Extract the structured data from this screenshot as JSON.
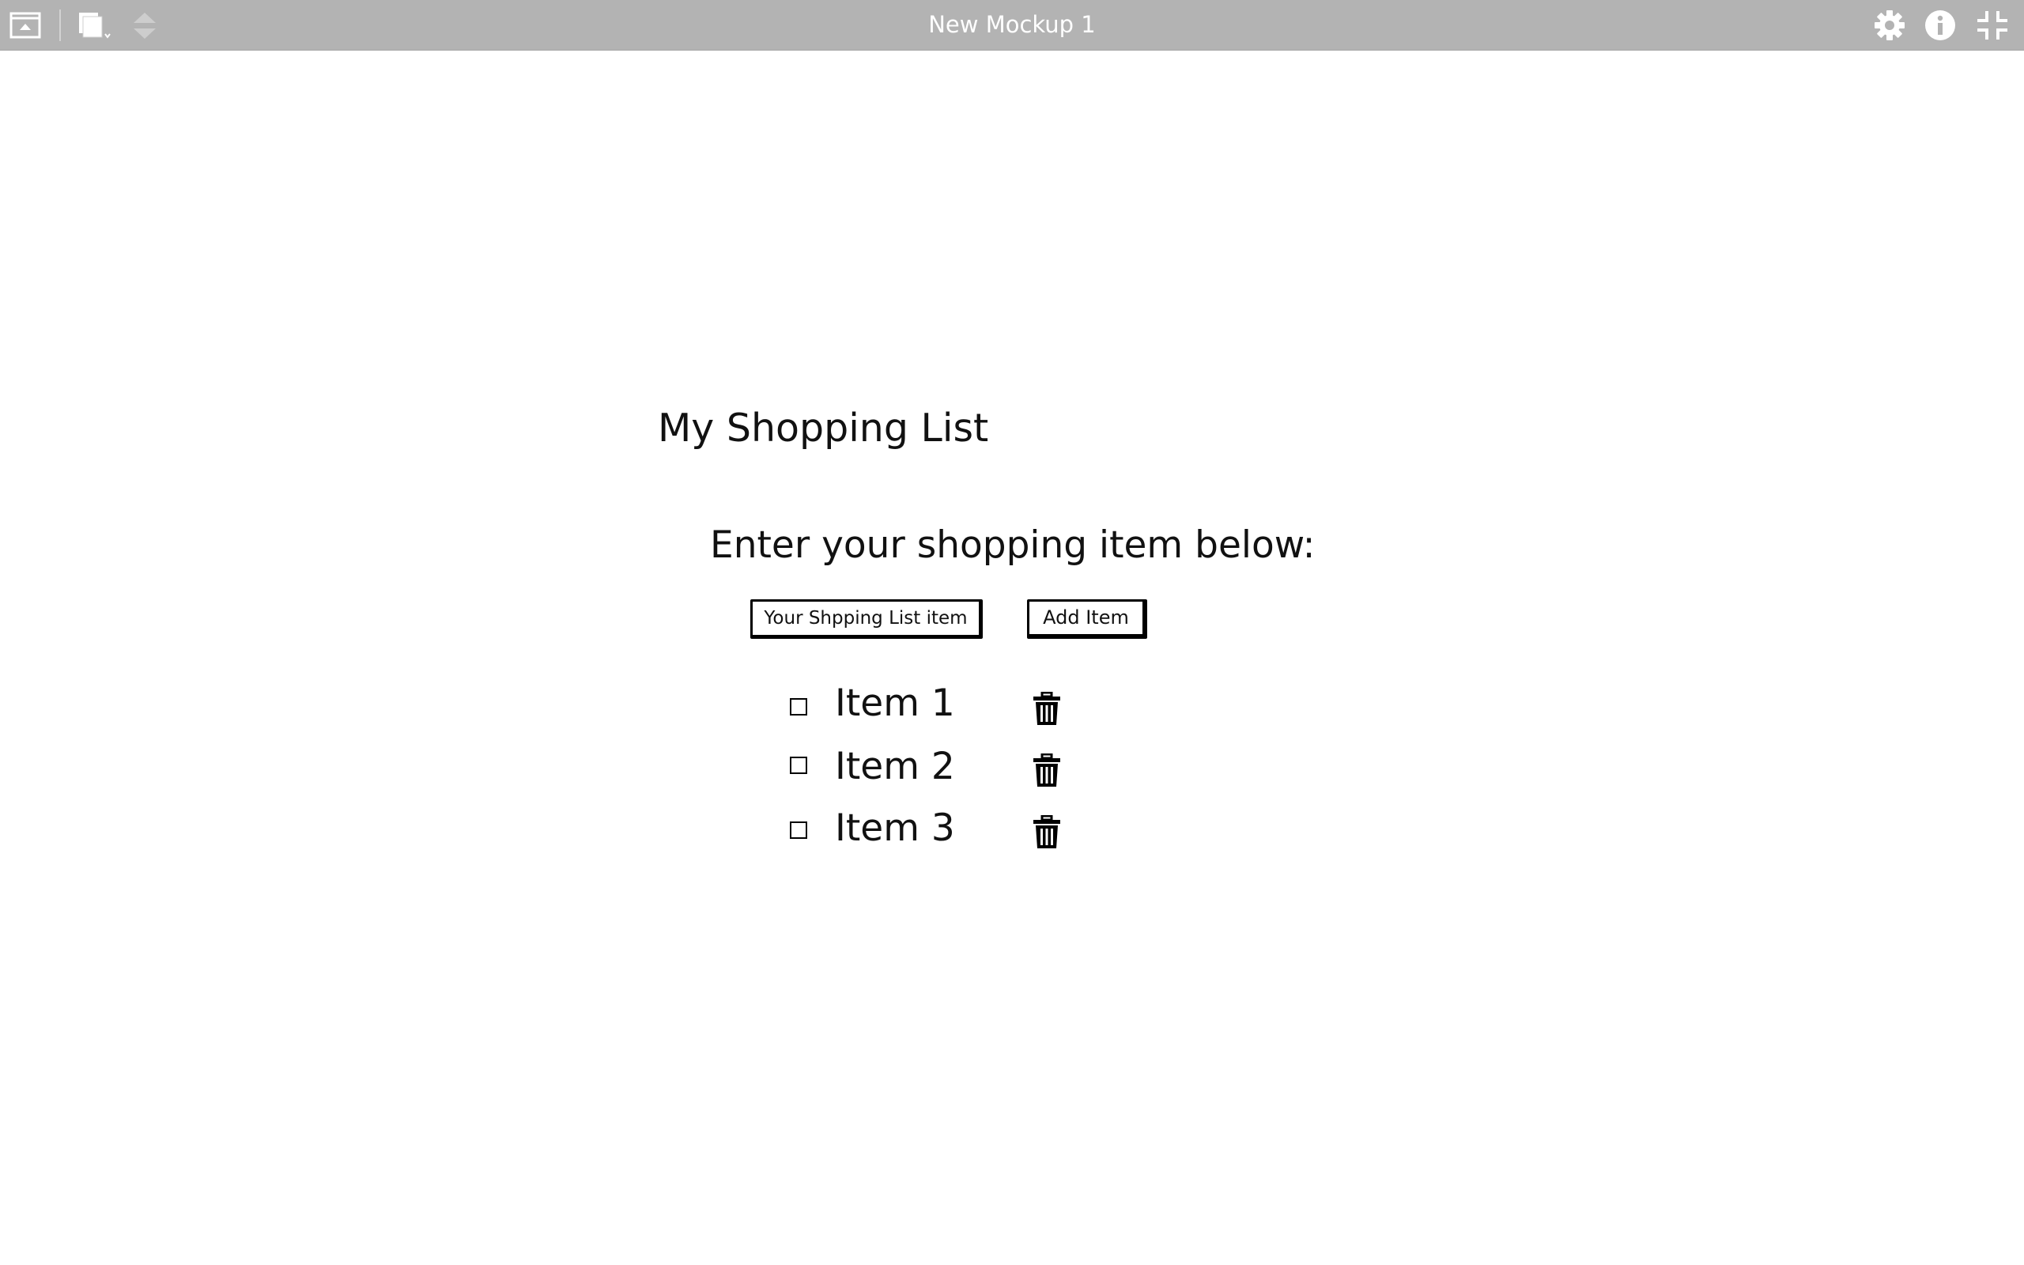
{
  "window": {
    "title": "New Mockup 1"
  },
  "toolbar": {
    "left_icons": [
      "screen-up-icon",
      "copy-icon",
      "sort-arrows-icon"
    ],
    "right_icons": [
      "gear-icon",
      "info-icon",
      "collapse-icon"
    ],
    "color": "#b3b3b3"
  },
  "mockup": {
    "title": "My Shopping List",
    "instruction": "Enter your shopping item below:",
    "input_value": "Your Shpping List item",
    "add_button_label": "Add Item",
    "items": [
      {
        "label": "Item 1",
        "checked": false
      },
      {
        "label": "Item 2",
        "checked": false
      },
      {
        "label": "Item 3",
        "checked": false
      }
    ]
  }
}
